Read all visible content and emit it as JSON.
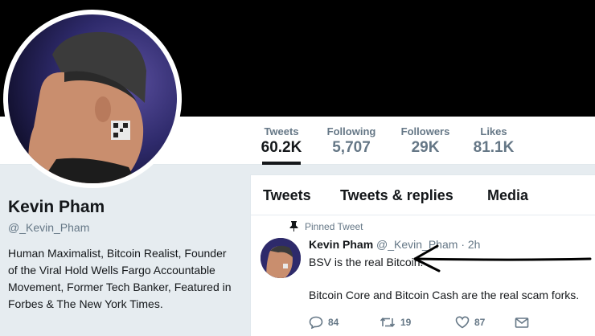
{
  "stats": [
    {
      "label": "Tweets",
      "value": "60.2K",
      "active": true
    },
    {
      "label": "Following",
      "value": "5,707",
      "active": false
    },
    {
      "label": "Followers",
      "value": "29K",
      "active": false
    },
    {
      "label": "Likes",
      "value": "81.1K",
      "active": false
    }
  ],
  "profile": {
    "name": "Kevin Pham",
    "handle": "@_Kevin_Pham",
    "bio": "Human Maximalist, Bitcoin Realist, Founder of the Viral Hold Wells Fargo Accountable Movement, Former Tech Banker, Featured in Forbes & The New York Times."
  },
  "tabs": [
    "Tweets",
    "Tweets & replies",
    "Media"
  ],
  "tweet": {
    "pinned_label": "Pinned Tweet",
    "author_name": "Kevin Pham",
    "author_handle": "@_Kevin_Pham",
    "separator": "·",
    "time": "2h",
    "line1": "BSV is the real Bitcoin.",
    "line2": "Bitcoin Core and Bitcoin Cash are the real scam forks.",
    "replies": "84",
    "retweets": "19",
    "likes": "87"
  },
  "colors": {
    "banner": "#000000",
    "secondary_text": "#657786",
    "page_background": "#e6ecf0"
  }
}
